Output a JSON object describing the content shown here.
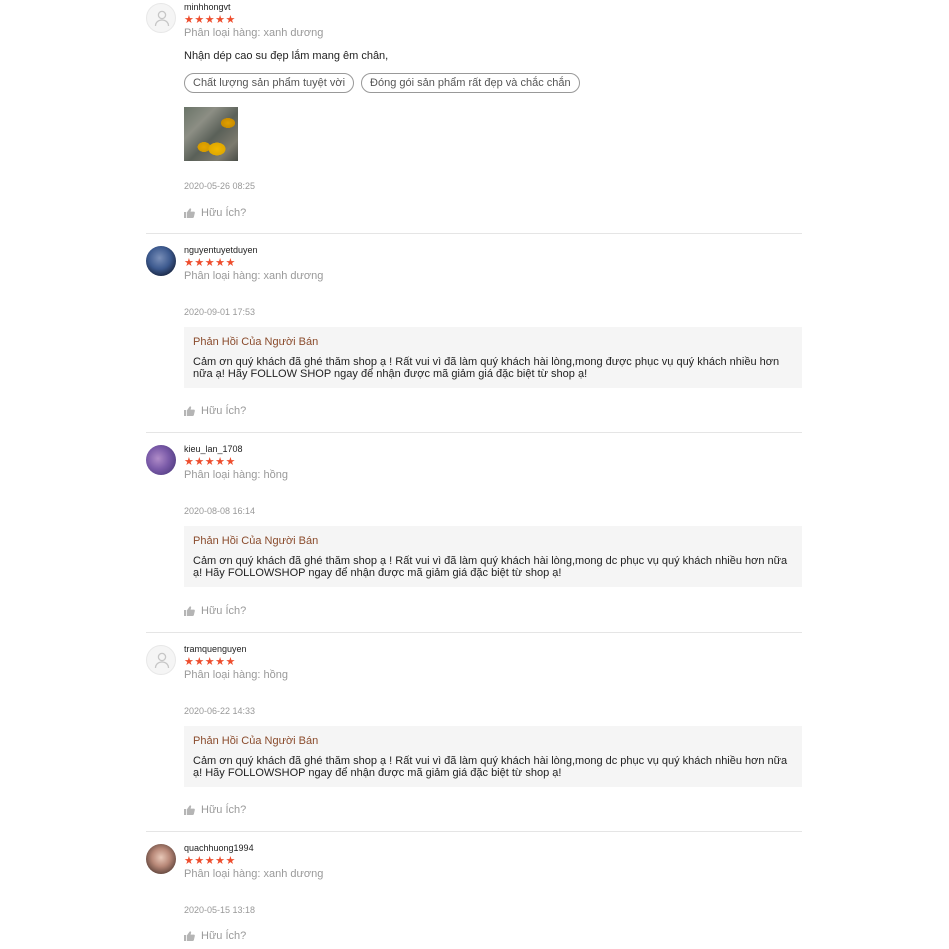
{
  "reviews": [
    {
      "username": "minhhongvt",
      "stars": "★★★★★",
      "variant": "Phân loại hàng: xanh dương",
      "comment": "Nhận dép cao su đẹp lắm mang êm chân,",
      "tags": [
        "Chất lượng sản phẩm tuyệt vời",
        "Đóng gói sản phẩm rất đẹp và chắc chắn"
      ],
      "time": "2020-05-26 08:25",
      "helpful": "Hữu Ích?"
    },
    {
      "username": "nguyentuyetduyen",
      "stars": "★★★★★",
      "variant": "Phân loại hàng: xanh dương",
      "time": "2020-09-01 17:53",
      "reply_title": "Phản Hồi Của Người Bán",
      "reply_text": "Cảm ơn quý khách đã ghé thăm shop ạ ! Rất vui vì đã làm quý khách hài lòng,mong được phục vụ quý khách nhiều hơn nữa ạ! Hãy FOLLOW SHOP ngay để nhận được mã giảm giá đặc biệt từ shop ạ!",
      "helpful": "Hữu Ích?"
    },
    {
      "username": "kieu_lan_1708",
      "stars": "★★★★★",
      "variant": "Phân loại hàng: hồng",
      "time": "2020-08-08 16:14",
      "reply_title": "Phản Hồi Của Người Bán",
      "reply_text": "Cảm ơn quý khách đã ghé thăm shop ạ ! Rất vui vì đã làm quý khách hài lòng,mong dc phục vụ quý khách nhiều hơn nữa ạ! Hãy FOLLOWSHOP ngay để nhận được mã giảm giá đặc biệt từ shop ạ!",
      "helpful": "Hữu Ích?"
    },
    {
      "username": "tramquenguyen",
      "stars": "★★★★★",
      "variant": "Phân loại hàng: hồng",
      "time": "2020-06-22 14:33",
      "reply_title": "Phản Hồi Của Người Bán",
      "reply_text": "Cảm ơn quý khách đã ghé thăm shop ạ ! Rất vui vì đã làm quý khách hài lòng,mong dc phục vụ quý khách nhiều hơn nữa ạ! Hãy FOLLOWSHOP ngay để nhận được mã giảm giá đặc biệt từ shop ạ!",
      "helpful": "Hữu Ích?"
    },
    {
      "username": "quachhuong1994",
      "stars": "★★★★★",
      "variant": "Phân loại hàng: xanh dương",
      "time": "2020-05-15 13:18",
      "helpful": "Hữu Ích?"
    }
  ],
  "colors": {
    "star": "#ee4d2d",
    "reply_title": "#8a4b2c",
    "muted": "#999999"
  },
  "icons": {
    "default_avatar": "user-silhouette-icon",
    "helpful": "thumbs-up-icon"
  }
}
